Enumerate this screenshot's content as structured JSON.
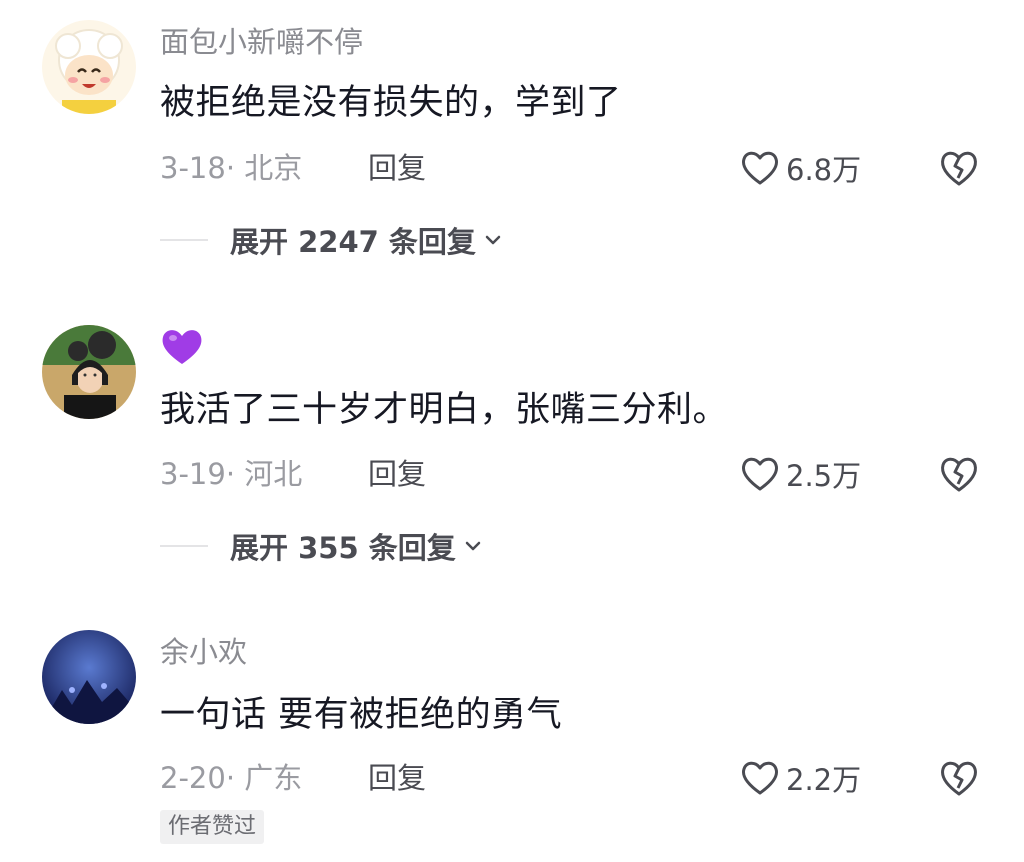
{
  "comments": [
    {
      "username": "面包小新嚼不停",
      "text": "被拒绝是没有损失的，学到了",
      "meta": "3-18· 北京",
      "reply_label": "回复",
      "likes": "6.8万",
      "expand_label": "展开 2247 条回复"
    },
    {
      "username_icon": "purple-heart-icon",
      "text": "我活了三十岁才明白，张嘴三分利。",
      "meta": "3-19· 河北",
      "reply_label": "回复",
      "likes": "2.5万",
      "expand_label": "展开 355 条回复"
    },
    {
      "username": "余小欢",
      "text": "一句话 要有被拒绝的勇气",
      "meta": "2-20· 广东",
      "reply_label": "回复",
      "likes": "2.2万",
      "badge": "作者赞过"
    }
  ],
  "colors": {
    "username": "#8a8b91",
    "text": "#161823",
    "meta": "#9a9ba1",
    "action": "#4a4b52",
    "badge_bg": "#f0f0f1",
    "purple_heart": "#a03ce6"
  }
}
